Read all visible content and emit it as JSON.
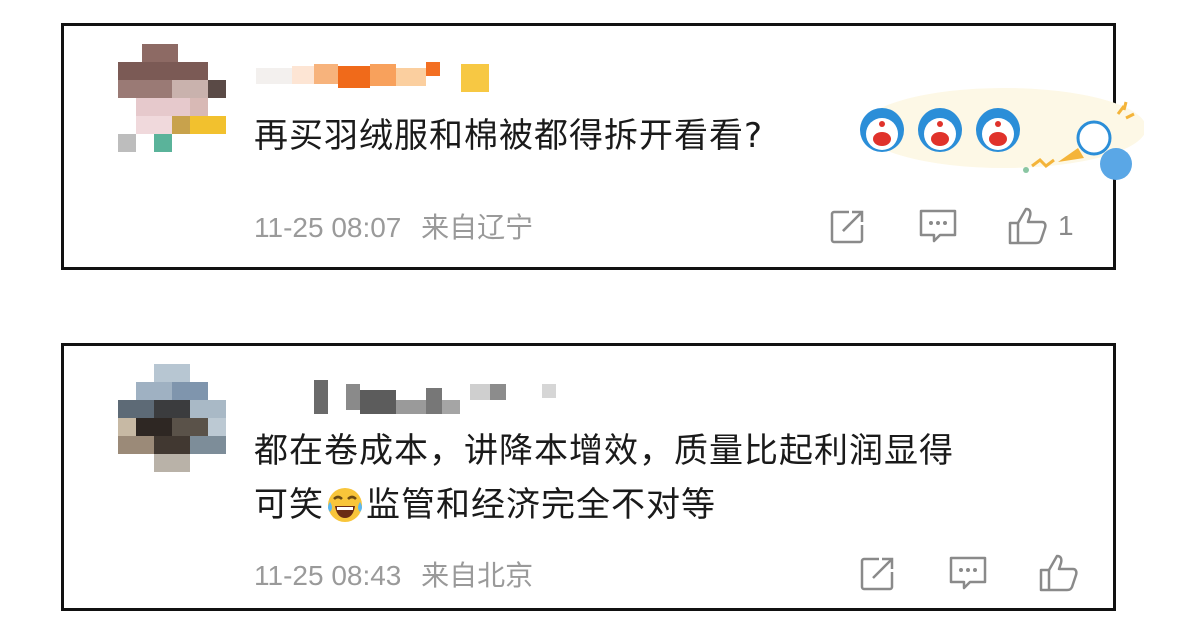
{
  "comments": [
    {
      "text": "再买羽绒服和棉被都得拆开看看?",
      "time": "11-25 08:07",
      "location": "来自辽宁",
      "like_count": "1",
      "icons": [
        "share-icon",
        "comment-icon",
        "like-icon"
      ],
      "sticker": "doraemon-megaphone-sticker"
    },
    {
      "text_line1": "都在卷成本，讲降本增效，质量比起利润显得",
      "text_line2_a": "可笑",
      "text_line2_b": "监管和经济完全不对等",
      "emoji": "laugh-cry-emoji",
      "time": "11-25 08:43",
      "location": "来自北京",
      "icons": [
        "share-icon",
        "comment-icon",
        "like-icon"
      ]
    }
  ],
  "colors": {
    "border": "#111111",
    "text": "#1a1a1a",
    "meta": "#9a9a9a",
    "icon": "#8a8a8a"
  }
}
